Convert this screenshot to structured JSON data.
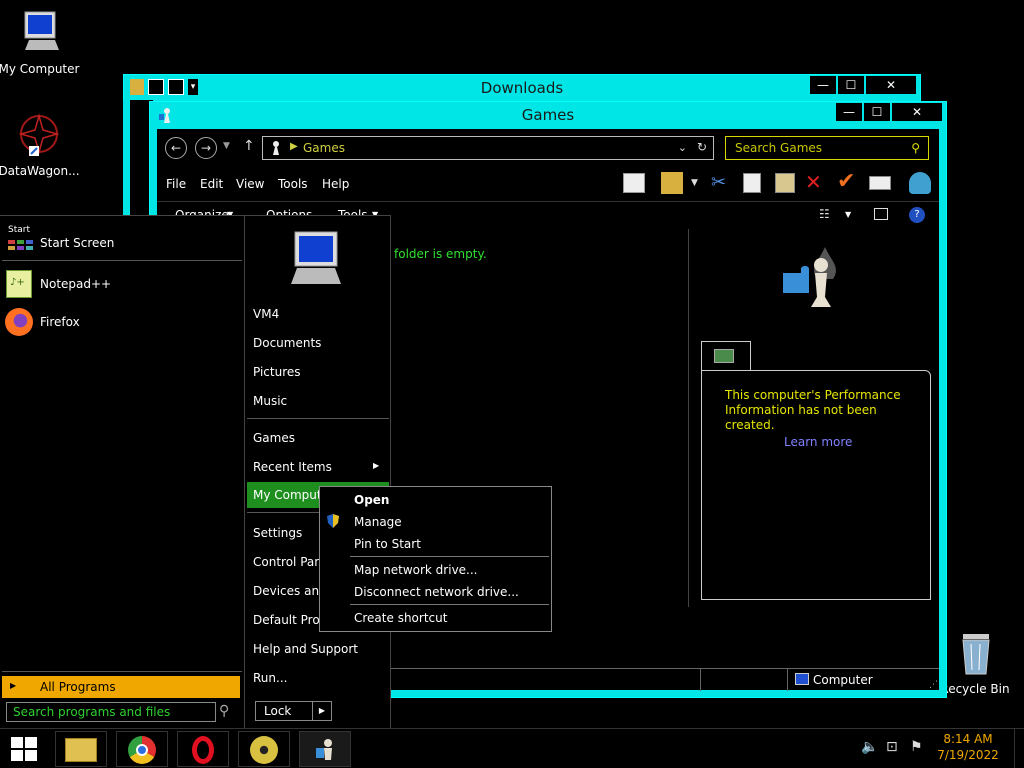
{
  "desktop": {
    "icons": [
      {
        "label": "My Computer"
      },
      {
        "label": "DataWagon..."
      },
      {
        "label": "Recycle Bin"
      }
    ]
  },
  "downloads_window": {
    "title": "Downloads"
  },
  "games_window": {
    "title": "Games",
    "breadcrumb": "Games",
    "search_placeholder": "Search Games",
    "menu": [
      "File",
      "Edit",
      "View",
      "Tools",
      "Help"
    ],
    "commands": {
      "organize": "Organize",
      "options": "Options",
      "tools": "Tools"
    },
    "empty_text": "folder is empty.",
    "performance_text": "This computer's Performance Information has not been created.",
    "learn_more": "Learn more",
    "status_location": "Computer"
  },
  "start_menu": {
    "start_label": "Start",
    "start_screen": "Start Screen",
    "pinned": [
      "Notepad++",
      "Firefox"
    ],
    "all_programs": "All Programs",
    "search_placeholder": "Search programs and files",
    "right_items": [
      "VM4",
      "Documents",
      "Pictures",
      "Music",
      "Games",
      "Recent Items",
      "My Computer",
      "Settings",
      "Control Panel",
      "Devices and",
      "Default Prog",
      "Help and Support",
      "Run..."
    ],
    "lock": "Lock"
  },
  "context_menu": {
    "items": [
      "Open",
      "Manage",
      "Pin to Start",
      "Map network drive...",
      "Disconnect network drive...",
      "Create shortcut"
    ]
  },
  "taskbar": {
    "time": "8:14 AM",
    "date": "7/19/2022"
  },
  "colors": {
    "window_frame": "#00e5e5",
    "highlight_green": "#1e8f1e",
    "all_programs_bg": "#f0a800",
    "breadcrumb_text": "#d0d040",
    "info_text": "#e6e600",
    "link_text": "#8080ff"
  }
}
